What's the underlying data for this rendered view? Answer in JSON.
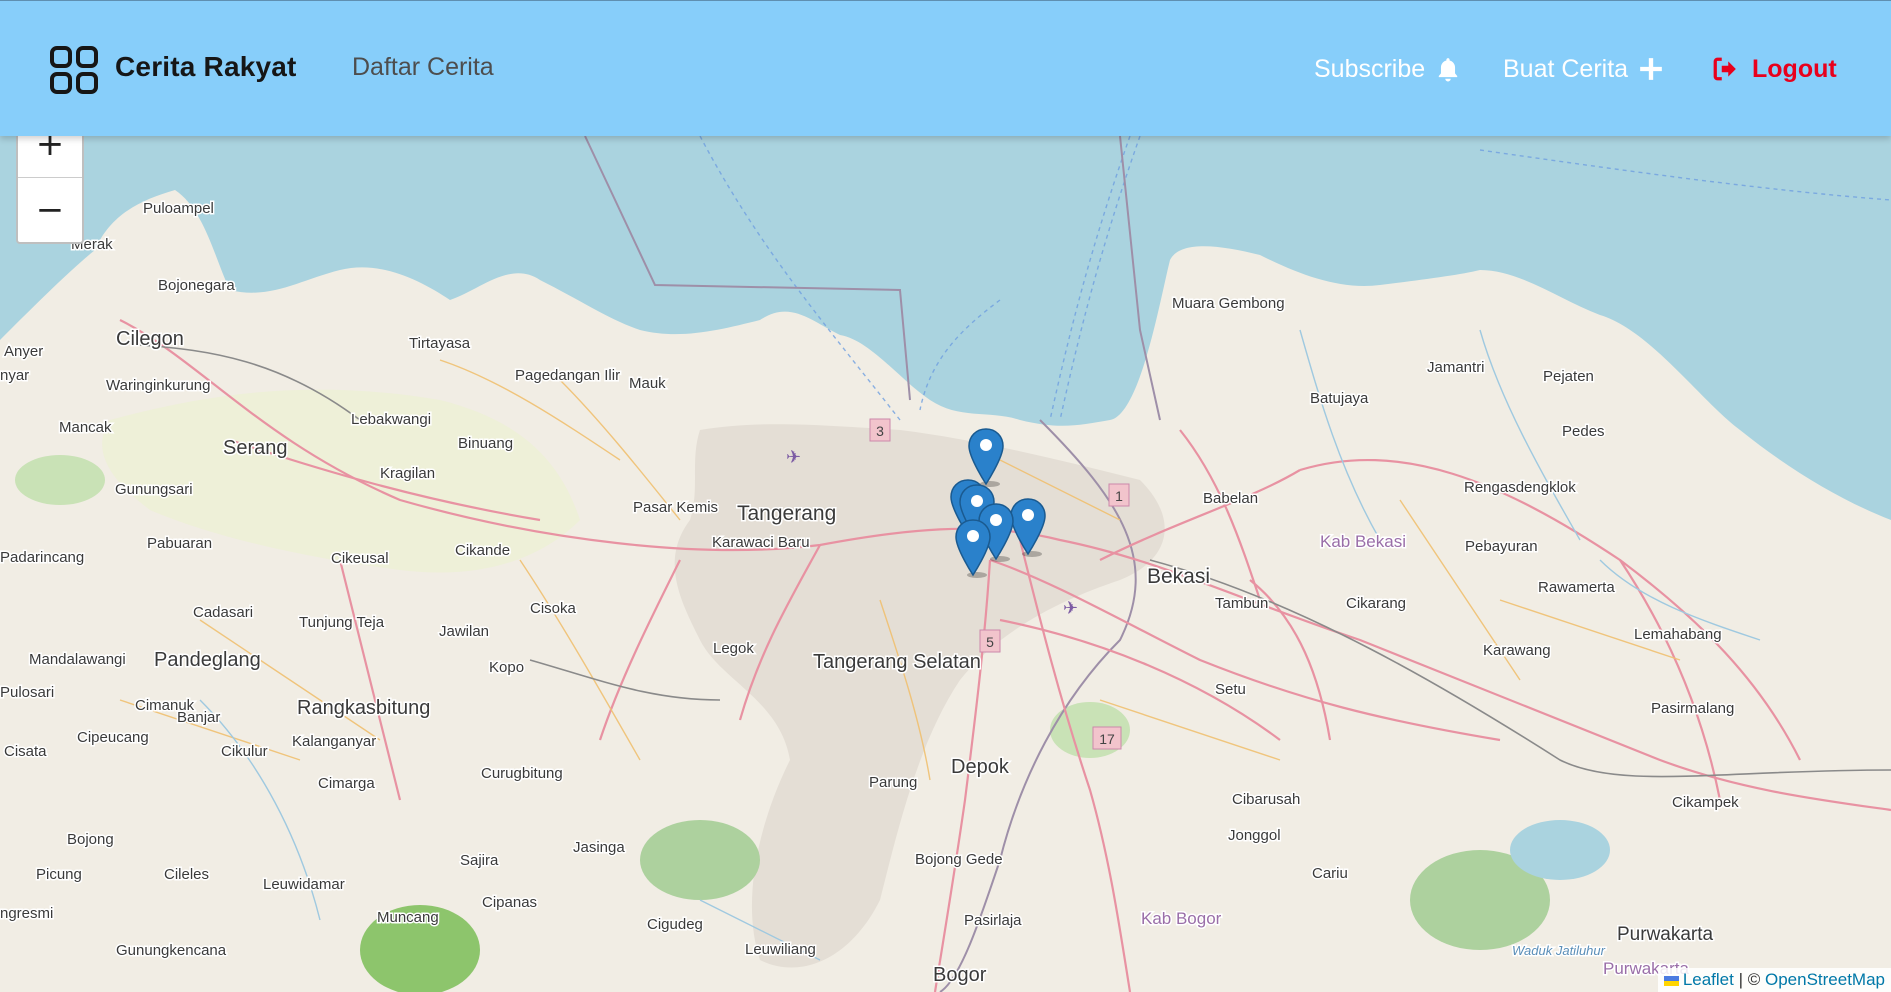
{
  "header": {
    "brand": "Cerita Rakyat",
    "nav_list": "Daftar Cerita",
    "subscribe": "Subscribe",
    "create": "Buat Cerita",
    "logout": "Logout",
    "icons": {
      "logo": "grid-icon",
      "subscribe": "bell-icon",
      "create": "plus-icon",
      "logout": "sign-out-icon"
    },
    "colors": {
      "bar": "#87cefa",
      "logout": "#e8001c",
      "brand_text": "#161616"
    }
  },
  "map": {
    "zoom_in": "+",
    "zoom_out": "−",
    "attribution": {
      "leaflet": "Leaflet",
      "separator": " | © ",
      "osm": "OpenStreetMap"
    },
    "marker_color": "#2a81cb",
    "labels": {
      "pulo_ampel": "Puloampel",
      "merak": "Merak",
      "bojonegara": "Bojonegara",
      "anyer": "Anyer",
      "cilegon": "Cilegon",
      "nyar": "nyar",
      "waringinkurung": "Waringinkurung",
      "tirtayasa": "Tirtayasa",
      "pagedangan_ilir": "Pagedangan Ilir",
      "mauk": "Mauk",
      "lebakwangi": "Lebakwangi",
      "mancak": "Mancak",
      "serang": "Serang",
      "kragilan": "Kragilan",
      "binuang": "Binuang",
      "gunungsari": "Gunungsari",
      "pasar_kemis": "Pasar Kemis",
      "tangerang": "Tangerang",
      "karawaci_baru": "Karawaci Baru",
      "pabuaran": "Pabuaran",
      "padarincang": "Padarincang",
      "cikeusal": "Cikeusal",
      "cikande": "Cikande",
      "cisoka": "Cisoka",
      "cadasari": "Cadasari",
      "tunjung_teja": "Tunjung Teja",
      "jawilan": "Jawilan",
      "legok": "Legok",
      "mandalawangi": "Mandalawangi",
      "pandeglang": "Pandeglang",
      "kopo": "Kopo",
      "tangerang_selatan": "Tangerang Selatan",
      "pulosari": "Pulosari",
      "cimanuk": "Cimanuk",
      "banjar": "Banjar",
      "rangkasbitung": "Rangkasbitung",
      "cipeucang": "Cipeucang",
      "kalanganyar": "Kalanganyar",
      "cisata": "Cisata",
      "cikulur": "Cikulur",
      "curugbitung": "Curugbitung",
      "cimarga": "Cimarga",
      "parung": "Parung",
      "depok": "Depok",
      "bojong": "Bojong",
      "jasinga": "Jasinga",
      "sajira": "Sajira",
      "picung": "Picung",
      "cileles": "Cileles",
      "leuwidamar": "Leuwidamar",
      "cipanas": "Cipanas",
      "muncang": "Muncang",
      "ngresmi": "ngresmi",
      "cigudeg": "Cigudeg",
      "gunungkencana": "Gunungkencana",
      "leuwiliang": "Leuwiliang",
      "bojong_gede": "Bojong Gede",
      "pasirlaja": "Pasirlaja",
      "bogor": "Bogor",
      "muara_gembong": "Muara Gembong",
      "jamantri": "Jamantri",
      "pejaten": "Pejaten",
      "batujaya": "Batujaya",
      "pedes": "Pedes",
      "rengasdengklok": "Rengasdengklok",
      "babelan": "Babelan",
      "kab_bekasi": "Kab Bekasi",
      "pebayuran": "Pebayuran",
      "bekasi": "Bekasi",
      "tambun": "Tambun",
      "cikarang": "Cikarang",
      "rawamerta": "Rawamerta",
      "lemahabang": "Lemahabang",
      "karawang": "Karawang",
      "setu": "Setu",
      "pasirmalang": "Pasirmalang",
      "cibarusah": "Cibarusah",
      "jonggol": "Jonggol",
      "cikampek": "Cikampek",
      "cariu": "Cariu",
      "kab_bogor": "Kab Bogor",
      "purwakarta": "Purwakarta",
      "waduk_jatiluhur": "Waduk Jatiluhur",
      "purwakarta_kab": "Purwakarta",
      "shield_3": "3",
      "shield_1": "1",
      "shield_5": "5",
      "shield_17": "17"
    }
  }
}
